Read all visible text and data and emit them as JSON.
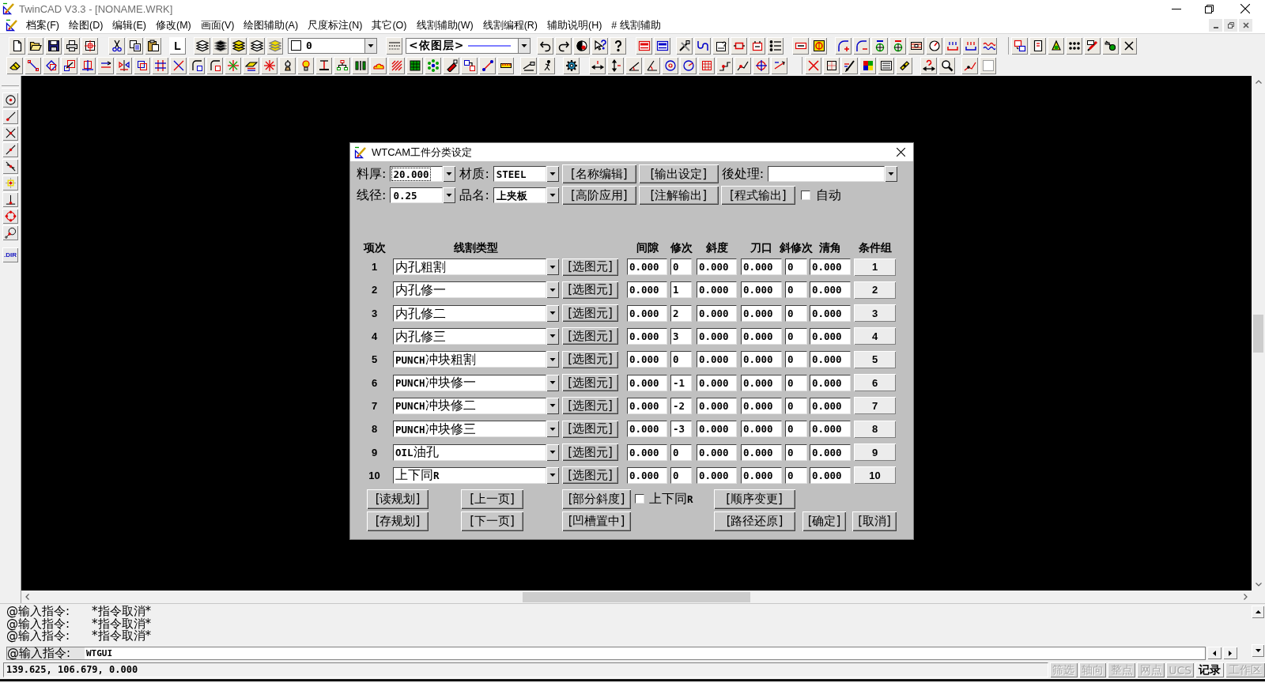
{
  "window": {
    "title": "TwinCAD V3.3 - [NONAME.WRK]"
  },
  "menu_bar": {
    "items": [
      "档案(F)",
      "绘图(D)",
      "编辑(E)",
      "修改(M)",
      "画面(V)",
      "绘图辅助(A)",
      "尺度标注(N)",
      "其它(O)",
      "线割辅助(W)",
      "线割编程(R)",
      "辅助说明(H)",
      "# 线割辅助"
    ]
  },
  "toolbar": {
    "text_button": "L",
    "color_field": {
      "value": "0"
    },
    "linetype_field": {
      "value": "<依图层>"
    }
  },
  "side_toolbar": {
    "text_button": ".DIR"
  },
  "dialog": {
    "title": "WTCAM工件分类设定",
    "top_rows": [
      [
        {
          "kind": "combo",
          "label": "料厚:",
          "value": "20.000",
          "focused": true
        },
        {
          "kind": "combo",
          "label": "材质:",
          "value": "STEEL",
          "focused": false
        },
        {
          "kind": "button",
          "label": "[名称编辑]"
        },
        {
          "kind": "button",
          "label": "[输出设定]"
        },
        {
          "kind": "combo",
          "label": "後处理:",
          "focused": false
        }
      ],
      [
        {
          "kind": "combo",
          "label": "线径:",
          "value": "0.25",
          "focused": false
        },
        {
          "kind": "combo",
          "label": "品名:",
          "value": "上夹板",
          "focused": false
        },
        {
          "kind": "button",
          "label": "[高阶应用]"
        },
        {
          "kind": "button",
          "label": "[注解输出]"
        },
        {
          "kind": "button",
          "label": "[程式输出]"
        },
        {
          "kind": "checkbox",
          "label": "自动",
          "checked": false
        }
      ]
    ],
    "table": {
      "columns": [
        "项次",
        "线割类型",
        "间隙",
        "修次",
        "斜度",
        "刀口",
        "斜修次",
        "清角",
        "条件组"
      ],
      "rows": [
        {
          "index": "1",
          "type": "内孔粗割",
          "select_button": "[选图元]",
          "gap": "0.000",
          "passes": "0",
          "taper": "0.000",
          "edge": "0.000",
          "taper_passes": "0",
          "corner": "0.000",
          "condition_group": "1"
        },
        {
          "index": "2",
          "type": "内孔修一",
          "select_button": "[选图元]",
          "gap": "0.000",
          "passes": "1",
          "taper": "0.000",
          "edge": "0.000",
          "taper_passes": "0",
          "corner": "0.000",
          "condition_group": "2"
        },
        {
          "index": "3",
          "type": "内孔修二",
          "select_button": "[选图元]",
          "gap": "0.000",
          "passes": "2",
          "taper": "0.000",
          "edge": "0.000",
          "taper_passes": "0",
          "corner": "0.000",
          "condition_group": "3"
        },
        {
          "index": "4",
          "type": "内孔修三",
          "select_button": "[选图元]",
          "gap": "0.000",
          "passes": "3",
          "taper": "0.000",
          "edge": "0.000",
          "taper_passes": "0",
          "corner": "0.000",
          "condition_group": "4"
        },
        {
          "index": "5",
          "type": "**PUNCH**冲块粗割",
          "select_button": "[选图元]",
          "gap": "0.000",
          "passes": "0",
          "taper": "0.000",
          "edge": "0.000",
          "taper_passes": "0",
          "corner": "0.000",
          "condition_group": "5"
        },
        {
          "index": "6",
          "type": "**PUNCH**冲块修一",
          "select_button": "[选图元]",
          "gap": "0.000",
          "passes": "-1",
          "taper": "0.000",
          "edge": "0.000",
          "taper_passes": "0",
          "corner": "0.000",
          "condition_group": "6"
        },
        {
          "index": "7",
          "type": "**PUNCH**冲块修二",
          "select_button": "[选图元]",
          "gap": "0.000",
          "passes": "-2",
          "taper": "0.000",
          "edge": "0.000",
          "taper_passes": "0",
          "corner": "0.000",
          "condition_group": "7"
        },
        {
          "index": "8",
          "type": "**PUNCH**冲块修三",
          "select_button": "[选图元]",
          "gap": "0.000",
          "passes": "-3",
          "taper": "0.000",
          "edge": "0.000",
          "taper_passes": "0",
          "corner": "0.000",
          "condition_group": "8"
        },
        {
          "index": "9",
          "type": "**OIL**油孔",
          "select_button": "[选图元]",
          "gap": "0.000",
          "passes": "0",
          "taper": "0.000",
          "edge": "0.000",
          "taper_passes": "0",
          "corner": "0.000",
          "condition_group": "9"
        },
        {
          "index": "10",
          "type": "上下同**R**",
          "select_button": "[选图元]",
          "gap": "0.000",
          "passes": "0",
          "taper": "0.000",
          "edge": "0.000",
          "taper_passes": "0",
          "corner": "0.000",
          "condition_group": "10"
        }
      ]
    },
    "bottom_rows": [
      [
        {
          "kind": "button",
          "label": "[读规划]"
        },
        {
          "kind": "button",
          "label": "[上一页]"
        },
        {
          "kind": "button",
          "label": "[部分斜度]"
        },
        {
          "kind": "checkbox",
          "label": "上下同**R**",
          "checked": false
        },
        {
          "kind": "button",
          "label": "[顺序变更]"
        }
      ],
      [
        {
          "kind": "button",
          "label": "[存规划]"
        },
        {
          "kind": "button",
          "label": "[下一页]"
        },
        {
          "kind": "button",
          "label": "[凹槽置中]"
        },
        {
          "kind": "button",
          "label": "[路径还原]"
        },
        {
          "kind": "button",
          "label": "[确定]"
        },
        {
          "kind": "button",
          "label": "[取消]"
        }
      ]
    ]
  },
  "command_area": {
    "history": [
      {
        "prompt": "@输入指令:",
        "text": "*指令取消*"
      },
      {
        "prompt": "@输入指令:",
        "text": "*指令取消*"
      },
      {
        "prompt": "@输入指令:",
        "text": "*指令取消*"
      }
    ],
    "input": {
      "prompt": "@输入指令:",
      "value": "WTGUI"
    }
  },
  "status_bar": {
    "coordinates": "139.625, 106.679, 0.000",
    "toggles": [
      {
        "label": "筛选",
        "on": false
      },
      {
        "label": "轴向",
        "on": false
      },
      {
        "label": "整点",
        "on": false
      },
      {
        "label": "网点",
        "on": false
      },
      {
        "label": "UCS",
        "on": false
      },
      {
        "label": "记录",
        "on": true
      },
      {
        "label": "工作区",
        "on": false
      }
    ]
  }
}
